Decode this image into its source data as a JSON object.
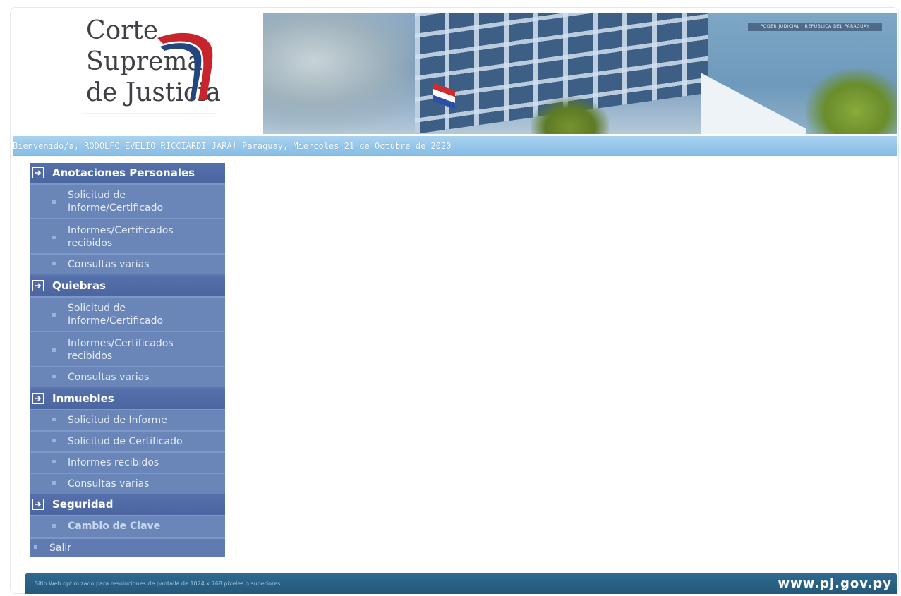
{
  "header": {
    "logo_lines": [
      "Corte",
      "Suprema",
      "de Justicia"
    ],
    "banner_tag": "PODER JUDICIAL · REPÚBLICA DEL PARAGUAY"
  },
  "welcome": {
    "text": "Bienvenido/a, RODOLFO EVELIO RICCIARDI JARA! Paraguay, Miércoles 21 de Octubre de 2020"
  },
  "menu": {
    "sections": [
      {
        "label": "Anotaciones Personales",
        "items": [
          "Solicitud de Informe/Certificado",
          "Informes/Certificados recibidos",
          "Consultas varias"
        ]
      },
      {
        "label": "Quiebras",
        "items": [
          "Solicitud de Informe/Certificado",
          "Informes/Certificados recibidos",
          "Consultas varias"
        ]
      },
      {
        "label": "Inmuebles",
        "items": [
          "Solicitud de Informe",
          "Solicitud de Certificado",
          "Informes recibidos",
          "Consultas varias"
        ]
      },
      {
        "label": "Seguridad",
        "items": [
          "Cambio de Clave"
        ]
      }
    ],
    "exit_label": "Salir"
  },
  "footer": {
    "note": "Sitio Web optimizado para resoluciones de pantalla de 1024 x 768 pixeles o superiores",
    "site": "www.pj.gov.py"
  },
  "colors": {
    "welcome_bar": "#84bce6",
    "menu_bg": "#5b77ad",
    "section_header": "#4b65a0",
    "footer_bg": "#2f6a93"
  }
}
